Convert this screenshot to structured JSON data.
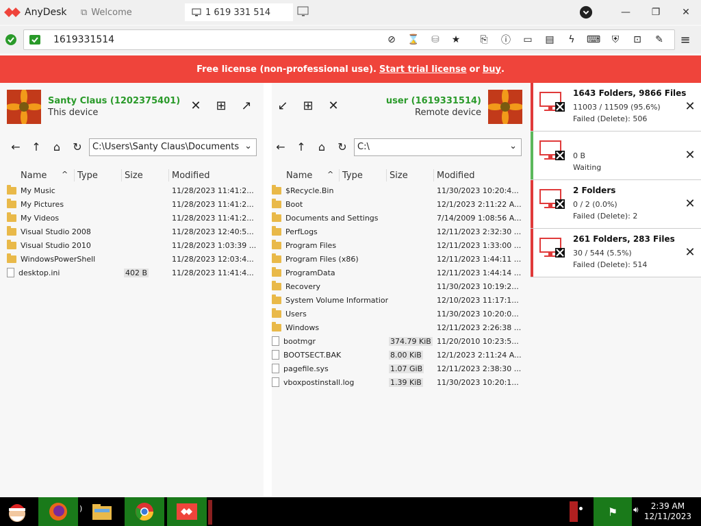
{
  "app": {
    "name": "AnyDesk"
  },
  "tabs": [
    {
      "label": "Welcome"
    },
    {
      "label": "1 619 331 514"
    }
  ],
  "address": {
    "value": "1619331514"
  },
  "banner": {
    "prefix": "Free license (non-professional use).",
    "trial_link": "Start trial license",
    "middle": "or",
    "buy_link": "buy",
    "suffix": "."
  },
  "local": {
    "name": "Santy Claus (1202375401)",
    "subtitle": "This device",
    "path": "C:\\Users\\Santy Claus\\Documents",
    "columns": [
      "Name",
      "Type",
      "Size",
      "Modified"
    ],
    "rows": [
      {
        "name": "My Music",
        "kind": "folder",
        "size": "",
        "modified": "11/28/2023 11:41:2..."
      },
      {
        "name": "My Pictures",
        "kind": "folder",
        "size": "",
        "modified": "11/28/2023 11:41:2..."
      },
      {
        "name": "My Videos",
        "kind": "folder",
        "size": "",
        "modified": "11/28/2023 11:41:2..."
      },
      {
        "name": "Visual Studio 2008",
        "kind": "folder",
        "size": "",
        "modified": "11/28/2023 12:40:5..."
      },
      {
        "name": "Visual Studio 2010",
        "kind": "folder",
        "size": "",
        "modified": "11/28/2023 1:03:39 ..."
      },
      {
        "name": "WindowsPowerShell",
        "kind": "folder",
        "size": "",
        "modified": "11/28/2023 12:03:4..."
      },
      {
        "name": "desktop.ini",
        "kind": "file",
        "size": "402 B",
        "modified": "11/28/2023 11:41:4..."
      }
    ]
  },
  "remote": {
    "name": "user (1619331514)",
    "subtitle": "Remote device",
    "path": "C:\\",
    "columns": [
      "Name",
      "Type",
      "Size",
      "Modified"
    ],
    "rows": [
      {
        "name": "$Recycle.Bin",
        "kind": "folder",
        "size": "",
        "modified": "11/30/2023 10:20:4..."
      },
      {
        "name": "Boot",
        "kind": "folder",
        "size": "",
        "modified": "12/1/2023 2:11:22 A..."
      },
      {
        "name": "Documents and Settings",
        "kind": "folder",
        "size": "",
        "modified": "7/14/2009 1:08:56 A..."
      },
      {
        "name": "PerfLogs",
        "kind": "folder",
        "size": "",
        "modified": "12/11/2023 2:32:30 ..."
      },
      {
        "name": "Program Files",
        "kind": "folder",
        "size": "",
        "modified": "12/11/2023 1:33:00 ..."
      },
      {
        "name": "Program Files (x86)",
        "kind": "folder",
        "size": "",
        "modified": "12/11/2023 1:44:11 ..."
      },
      {
        "name": "ProgramData",
        "kind": "folder",
        "size": "",
        "modified": "12/11/2023 1:44:14 ..."
      },
      {
        "name": "Recovery",
        "kind": "folder",
        "size": "",
        "modified": "11/30/2023 10:19:2..."
      },
      {
        "name": "System Volume Information",
        "kind": "folder",
        "size": "",
        "modified": "12/10/2023 11:17:1..."
      },
      {
        "name": "Users",
        "kind": "folder",
        "size": "",
        "modified": "11/30/2023 10:20:0..."
      },
      {
        "name": "Windows",
        "kind": "folder",
        "size": "",
        "modified": "12/11/2023 2:26:38 ..."
      },
      {
        "name": "bootmgr",
        "kind": "file",
        "size": "374.79 KiB",
        "modified": "11/20/2010 10:23:5..."
      },
      {
        "name": "BOOTSECT.BAK",
        "kind": "file",
        "size": "8.00 KiB",
        "modified": "12/1/2023 2:11:24 A..."
      },
      {
        "name": "pagefile.sys",
        "kind": "file",
        "size": "1.07 GiB",
        "modified": "12/11/2023 2:38:30 ..."
      },
      {
        "name": "vboxpostinstall.log",
        "kind": "file",
        "size": "1.39 KiB",
        "modified": "11/30/2023 10:20:1..."
      }
    ]
  },
  "transfers": [
    {
      "title": "1643 Folders, 9866 Files",
      "progress": "11003 / 11509 (95.6%)",
      "status": "Failed (Delete): 506",
      "color": "#e03a3a"
    },
    {
      "title": "",
      "progress": "0 B",
      "status": "Waiting",
      "color": "#5cb85c"
    },
    {
      "title": "2 Folders",
      "progress": "0 / 2 (0.0%)",
      "status": "Failed (Delete): 2",
      "color": "#e03a3a"
    },
    {
      "title": "261 Folders, 283 Files",
      "progress": "30 / 544 (5.5%)",
      "status": "Failed (Delete): 514",
      "color": "#e03a3a"
    }
  ],
  "clock": {
    "time": "2:39 AM",
    "date": "12/11/2023"
  },
  "colors": {
    "accent": "#ef443b",
    "green": "#2a9a2a"
  }
}
